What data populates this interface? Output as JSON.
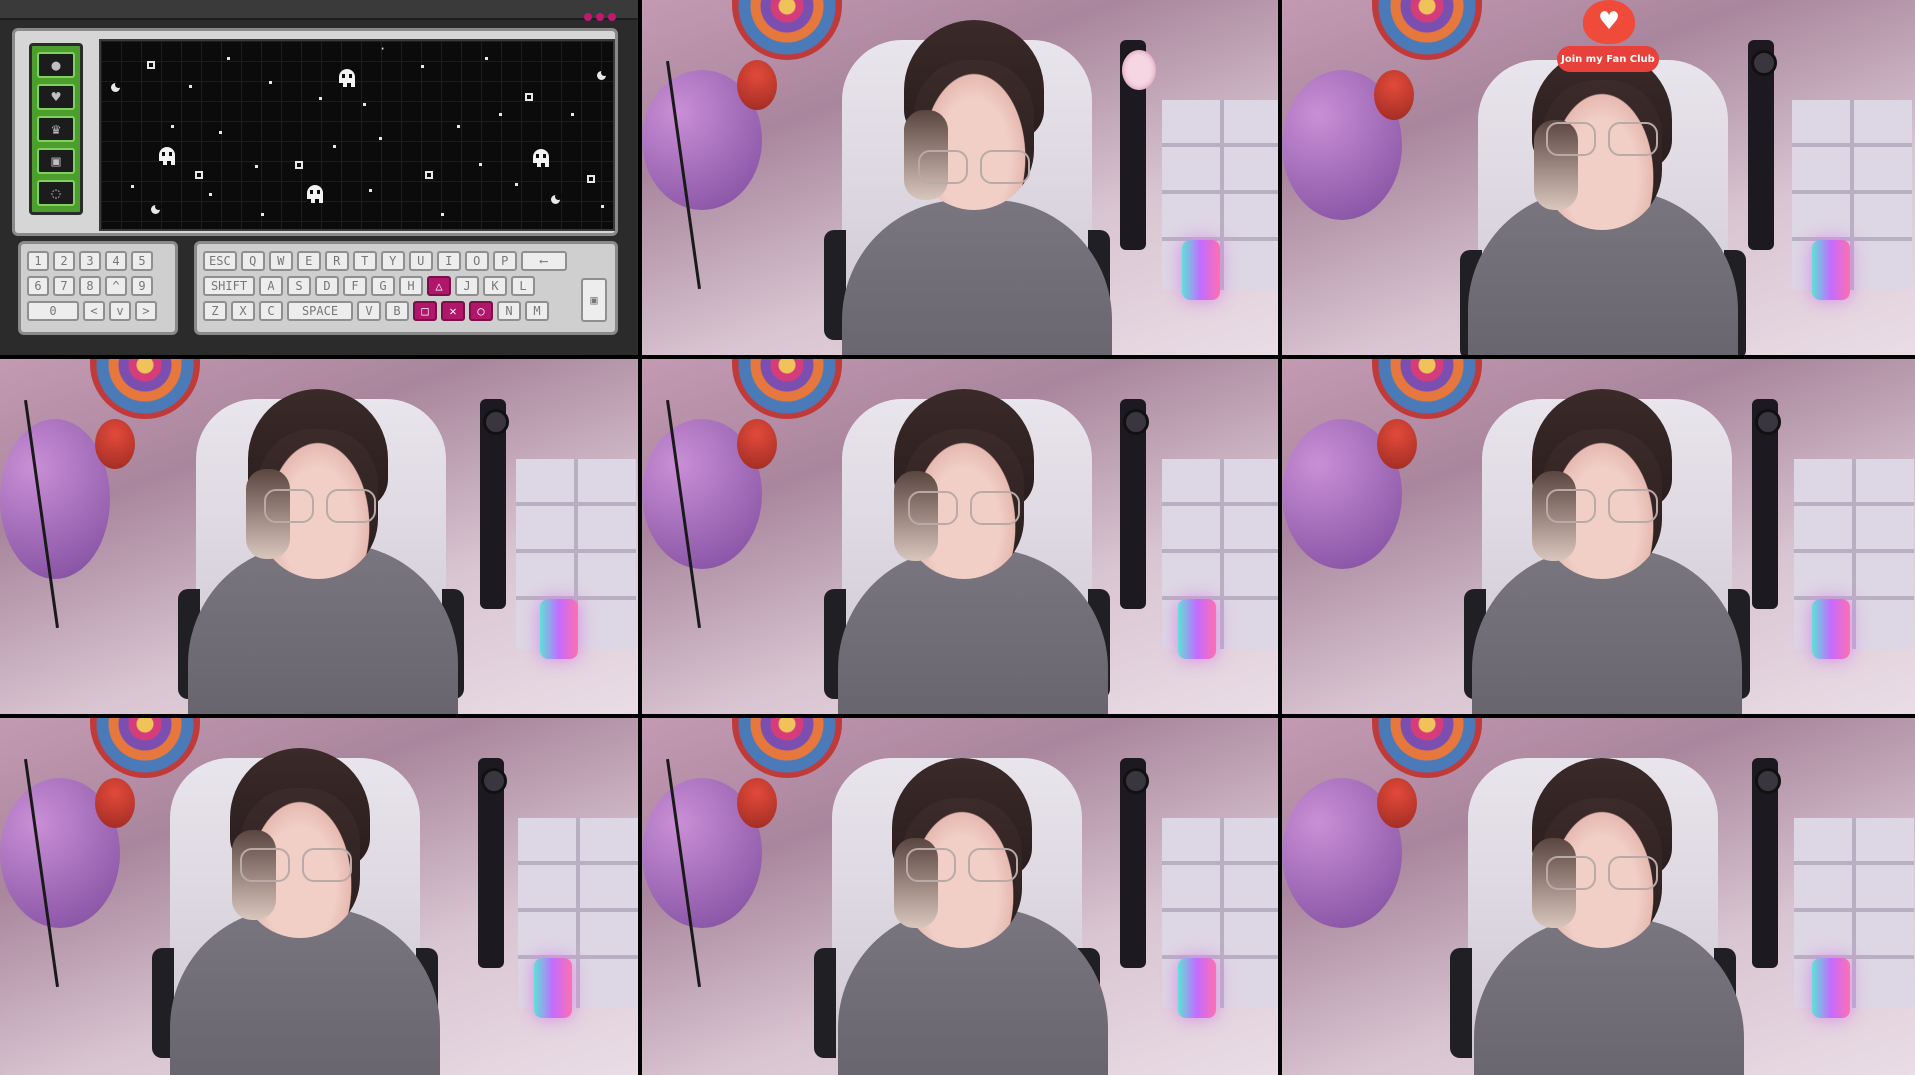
{
  "game": {
    "menu_icons": [
      "planet-icon",
      "heart-icon",
      "trophy-icon",
      "ghost-icon",
      "settings-dots-icon"
    ],
    "menu_glyphs": [
      "●",
      "♥",
      "♛",
      "▣",
      "◌"
    ],
    "keypad_left_rows": [
      [
        "1",
        "2",
        "3",
        "4",
        "5"
      ],
      [
        "6",
        "7",
        "8",
        "^",
        "9"
      ],
      [
        "0",
        "<",
        "v",
        ">"
      ]
    ],
    "keypad_right_rows": [
      [
        "ESC",
        "Q",
        "W",
        "E",
        "R",
        "T",
        "Y",
        "U",
        "I",
        "O",
        "P",
        "⟵"
      ],
      [
        "SHIFT",
        "A",
        "S",
        "D",
        "F",
        "G",
        "H",
        "△",
        "J",
        "K",
        "L"
      ],
      [
        "Z",
        "X",
        "C",
        "SPACE",
        "V",
        "B",
        "□",
        "✕",
        "○",
        "N",
        "M"
      ]
    ],
    "highlighted_keys": [
      "△",
      "□",
      "✕",
      "○"
    ],
    "accent_color": "#b0176a",
    "menu_color": "#4c9f2e"
  },
  "fan_club": {
    "label": "Join my Fan Club",
    "color": "#e8403a"
  },
  "tile_count": 9
}
